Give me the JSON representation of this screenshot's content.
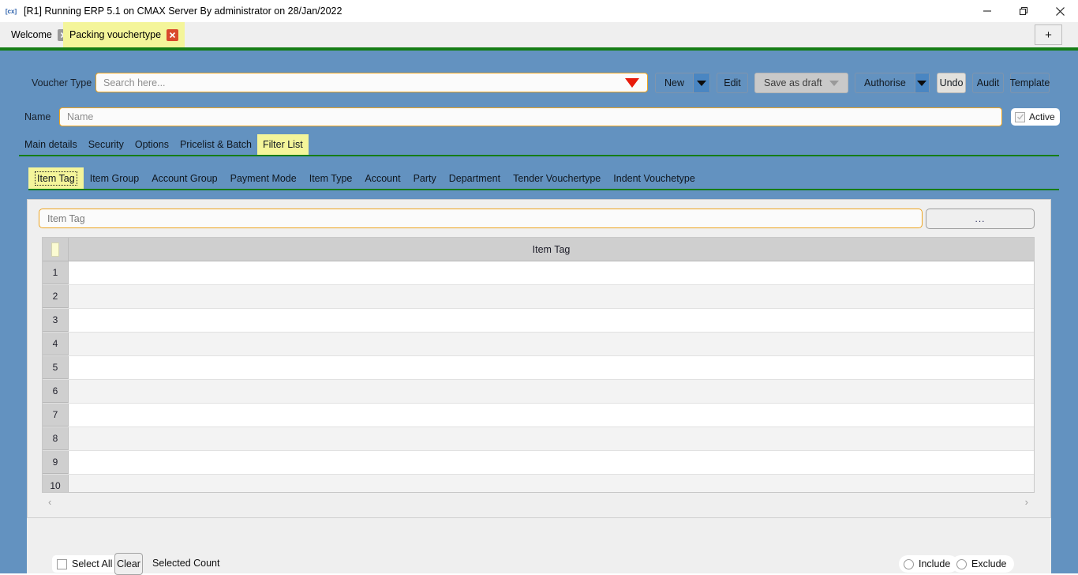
{
  "window": {
    "icon": "app-icon",
    "title": "[R1] Running ERP 5.1 on CMAX Server By administrator on 28/Jan/2022",
    "controls": {
      "minimize": "minimize-icon",
      "maximize": "restore-icon",
      "close": "close-icon"
    }
  },
  "tabbar": {
    "tabs": [
      {
        "label": "Welcome",
        "close": "x",
        "active": false
      },
      {
        "label": "Packing vouchertype",
        "close": "x",
        "active": true
      }
    ],
    "new_tab_label": "+"
  },
  "form": {
    "voucher_type_label": "Voucher Type",
    "voucher_type_placeholder": "Search here...",
    "voucher_type_value": "",
    "name_label": "Name",
    "name_placeholder": "Name",
    "name_value": "",
    "active_label": "Active"
  },
  "toolbar": {
    "new_label": "New",
    "edit_label": "Edit",
    "save_as_draft_label": "Save as draft",
    "authorise_label": "Authorise",
    "undo_label": "Undo",
    "audit_label": "Audit",
    "template_label": "Template"
  },
  "main_tabs": [
    {
      "label": "Main details",
      "active": false
    },
    {
      "label": "Security",
      "active": false
    },
    {
      "label": "Options",
      "active": false
    },
    {
      "label": "Pricelist & Batch",
      "active": false
    },
    {
      "label": "Filter List",
      "active": true
    }
  ],
  "sub_tabs": [
    {
      "label": "Item Tag",
      "active": true
    },
    {
      "label": "Item Group",
      "active": false
    },
    {
      "label": "Account Group",
      "active": false
    },
    {
      "label": "Payment Mode",
      "active": false
    },
    {
      "label": "Item Type",
      "active": false
    },
    {
      "label": "Account",
      "active": false
    },
    {
      "label": "Party",
      "active": false
    },
    {
      "label": "Department",
      "active": false
    },
    {
      "label": "Tender Vouchertype",
      "active": false
    },
    {
      "label": "Indent Vouchetype",
      "active": false
    }
  ],
  "panel": {
    "search_placeholder": "Item Tag",
    "search_value": "",
    "browse_label": "...",
    "grid": {
      "column_header": "Item Tag",
      "rows": [
        {
          "num": "1",
          "value": ""
        },
        {
          "num": "2",
          "value": ""
        },
        {
          "num": "3",
          "value": ""
        },
        {
          "num": "4",
          "value": ""
        },
        {
          "num": "5",
          "value": ""
        },
        {
          "num": "6",
          "value": ""
        },
        {
          "num": "7",
          "value": ""
        },
        {
          "num": "8",
          "value": ""
        },
        {
          "num": "9",
          "value": ""
        },
        {
          "num": "10",
          "value": ""
        }
      ],
      "scroll_left": "‹",
      "scroll_right": "›"
    }
  },
  "footer": {
    "select_all_label": "Select All",
    "clear_label": "Clear",
    "selected_count_label": "Selected Count",
    "include_label": "Include",
    "exclude_label": "Exclude"
  },
  "colors": {
    "app_blue": "#6392c0",
    "accent_orange": "#eda420",
    "green_rule": "#167d16",
    "active_tab_yellow": "#f4f59a",
    "dropdown_red": "#e81b0b"
  }
}
